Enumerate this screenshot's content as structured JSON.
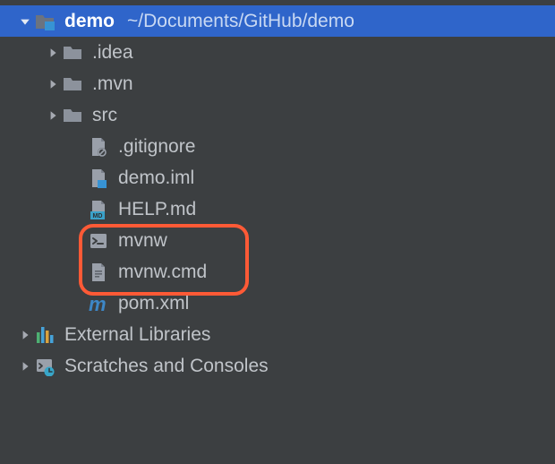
{
  "root": {
    "name": "demo",
    "path": "~/Documents/GitHub/demo",
    "children": [
      {
        "name": ".idea",
        "kind": "folder",
        "expandable": true
      },
      {
        "name": ".mvn",
        "kind": "folder",
        "expandable": true
      },
      {
        "name": "src",
        "kind": "folder",
        "expandable": true
      },
      {
        "name": ".gitignore",
        "kind": "ignore-file",
        "expandable": false
      },
      {
        "name": "demo.iml",
        "kind": "iml-file",
        "expandable": false
      },
      {
        "name": "HELP.md",
        "kind": "markdown-file",
        "expandable": false
      },
      {
        "name": "mvnw",
        "kind": "shell-file",
        "expandable": false,
        "highlighted": true
      },
      {
        "name": "mvnw.cmd",
        "kind": "text-file",
        "expandable": false,
        "highlighted": true
      },
      {
        "name": "pom.xml",
        "kind": "maven-file",
        "expandable": false
      }
    ]
  },
  "extras": [
    {
      "name": "External Libraries",
      "kind": "libraries",
      "expandable": true
    },
    {
      "name": "Scratches and Consoles",
      "kind": "scratches",
      "expandable": true
    }
  ]
}
